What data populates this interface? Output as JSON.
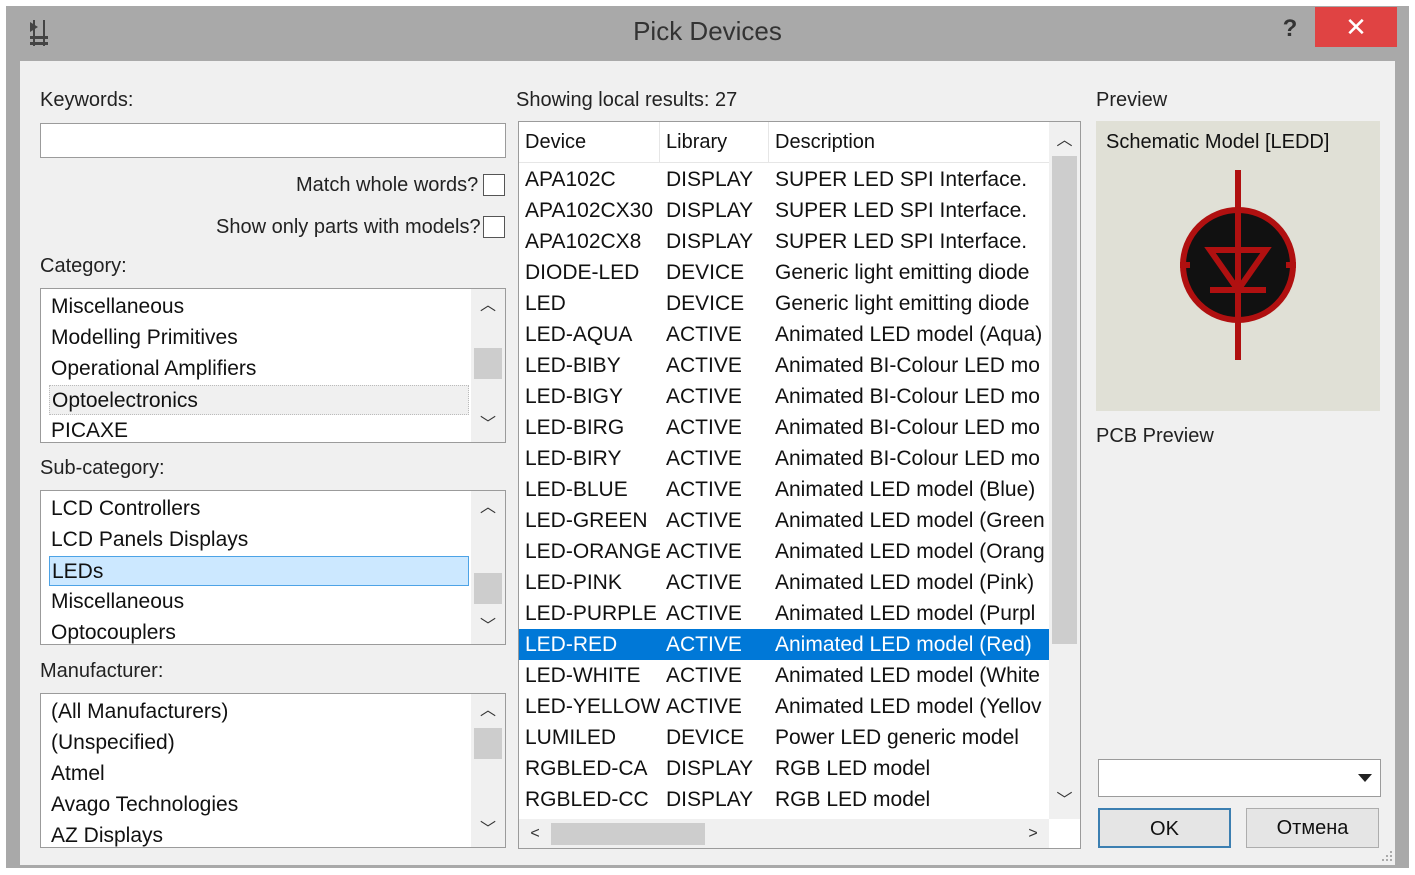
{
  "window": {
    "title": "Pick Devices",
    "help_label": "?",
    "close_label": "✕"
  },
  "keywords": {
    "label": "Keywords:",
    "value": "",
    "placeholder": ""
  },
  "options": {
    "match_whole_words": {
      "label": "Match whole words?",
      "checked": false
    },
    "show_only_models": {
      "label": "Show only parts with models?",
      "checked": false
    }
  },
  "category": {
    "label": "Category:",
    "items": [
      "Miscellaneous",
      "Modelling Primitives",
      "Operational Amplifiers",
      "Optoelectronics",
      "PICAXE"
    ],
    "focused": "Optoelectronics"
  },
  "subcategory": {
    "label": "Sub-category:",
    "items": [
      "LCD Controllers",
      "LCD Panels Displays",
      "LEDs",
      "Miscellaneous",
      "Optocouplers"
    ],
    "selected": "LEDs"
  },
  "manufacturer": {
    "label": "Manufacturer:",
    "items": [
      "(All Manufacturers)",
      "(Unspecified)",
      "Atmel",
      "Avago Technologies",
      "AZ Displays"
    ]
  },
  "results": {
    "label": "Showing local results: 27",
    "columns": [
      "Device",
      "Library",
      "Description"
    ],
    "rows": [
      [
        "APA102C",
        "DISPLAY",
        "SUPER LED SPI Interface."
      ],
      [
        "APA102CX30",
        "DISPLAY",
        "SUPER LED SPI Interface."
      ],
      [
        "APA102CX8",
        "DISPLAY",
        "SUPER LED SPI Interface."
      ],
      [
        "DIODE-LED",
        "DEVICE",
        "Generic light emitting diode"
      ],
      [
        "LED",
        "DEVICE",
        "Generic light emitting diode"
      ],
      [
        "LED-AQUA",
        "ACTIVE",
        "Animated LED model (Aqua)"
      ],
      [
        "LED-BIBY",
        "ACTIVE",
        "Animated BI-Colour LED mo"
      ],
      [
        "LED-BIGY",
        "ACTIVE",
        "Animated BI-Colour LED mo"
      ],
      [
        "LED-BIRG",
        "ACTIVE",
        "Animated BI-Colour LED mo"
      ],
      [
        "LED-BIRY",
        "ACTIVE",
        "Animated BI-Colour LED mo"
      ],
      [
        "LED-BLUE",
        "ACTIVE",
        "Animated LED model (Blue)"
      ],
      [
        "LED-GREEN",
        "ACTIVE",
        "Animated LED model (Green"
      ],
      [
        "LED-ORANGE",
        "ACTIVE",
        "Animated LED model (Orang"
      ],
      [
        "LED-PINK",
        "ACTIVE",
        "Animated LED model (Pink)"
      ],
      [
        "LED-PURPLE",
        "ACTIVE",
        "Animated LED model (Purpl"
      ],
      [
        "LED-RED",
        "ACTIVE",
        "Animated LED model (Red)"
      ],
      [
        "LED-WHITE",
        "ACTIVE",
        "Animated LED model (White"
      ],
      [
        "LED-YELLOW",
        "ACTIVE",
        "Animated LED model (Yellov"
      ],
      [
        "LUMILED",
        "DEVICE",
        "Power LED generic model"
      ],
      [
        "RGBLED-CA",
        "DISPLAY",
        "RGB LED model"
      ],
      [
        "RGBLED-CC",
        "DISPLAY",
        "RGB LED model"
      ]
    ],
    "selected_index": 15
  },
  "preview": {
    "label": "Preview",
    "schematic_title": "Schematic Model [LEDD]",
    "pcb_label": "PCB Preview",
    "symbol_color": "#b01010"
  },
  "footprint_combo": {
    "value": ""
  },
  "buttons": {
    "ok": "OK",
    "cancel": "Отмена"
  },
  "colors": {
    "selection": "#0078d7",
    "list_selection": "#cce8ff",
    "close": "#e04343"
  }
}
